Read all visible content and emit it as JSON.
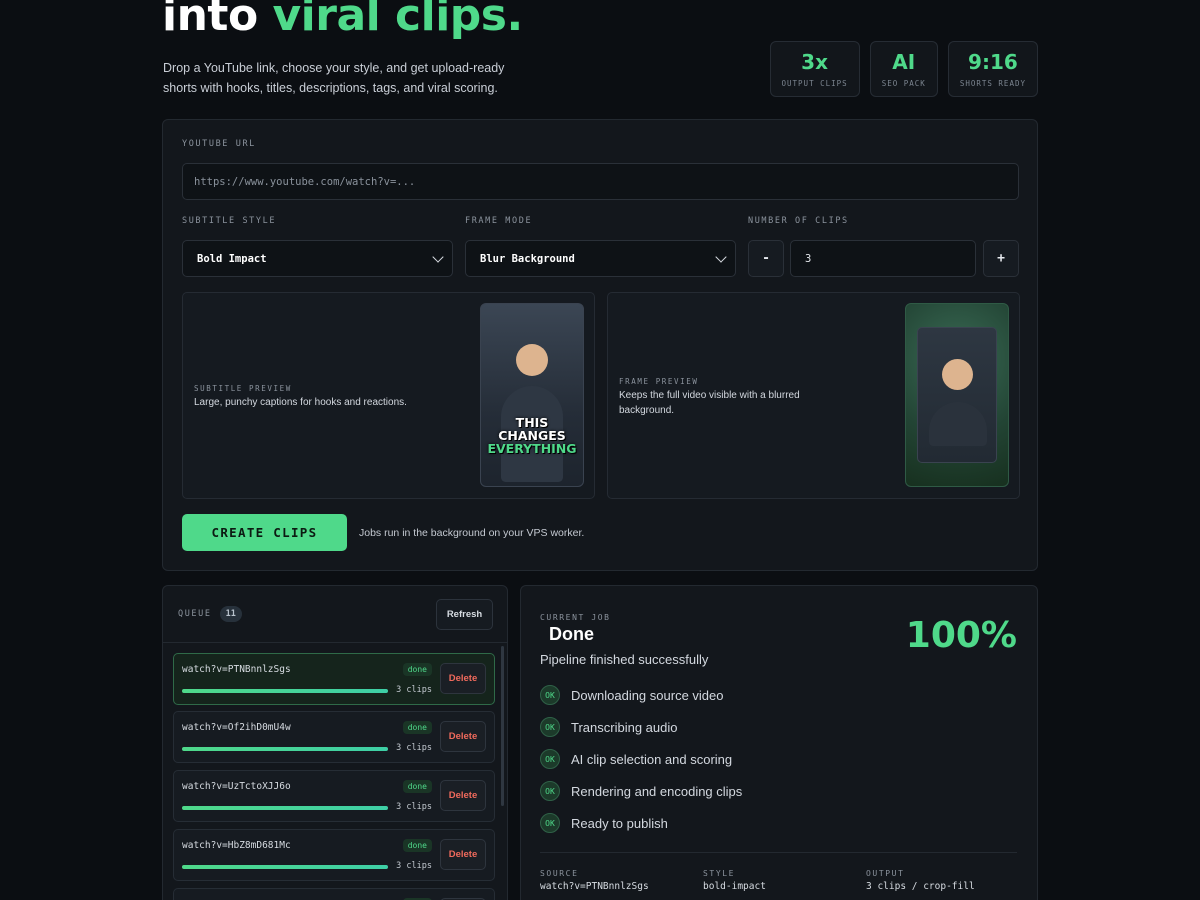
{
  "hero": {
    "title_prefix": "into ",
    "title_accent": "viral clips.",
    "subtitle": "Drop a YouTube link, choose your style, and get upload-ready shorts with hooks, titles, descriptions, tags, and viral scoring."
  },
  "stats": [
    {
      "value": "3x",
      "label": "OUTPUT CLIPS"
    },
    {
      "value": "AI",
      "label": "SEO PACK"
    },
    {
      "value": "9:16",
      "label": "SHORTS READY"
    }
  ],
  "form": {
    "url_label": "YOUTUBE URL",
    "url_placeholder": "https://www.youtube.com/watch?v=...",
    "subtitle_style_label": "SUBTITLE STYLE",
    "subtitle_style_value": "Bold Impact",
    "frame_mode_label": "FRAME MODE",
    "frame_mode_value": "Blur Background",
    "clips_label": "NUMBER OF CLIPS",
    "minus_label": "-",
    "plus_label": "+",
    "clips_value": "3",
    "subtitle_preview_label": "SUBTITLE PREVIEW",
    "subtitle_preview_desc": "Large, punchy captions for hooks and reactions.",
    "caption_line1": "THIS",
    "caption_line2": "CHANGES",
    "caption_line3": "EVERYTHING",
    "frame_preview_label": "FRAME PREVIEW",
    "frame_preview_desc": "Keeps the full video visible with a blurred background.",
    "create_button": "CREATE CLIPS",
    "create_note": "Jobs run in the background on your VPS worker."
  },
  "queue": {
    "label": "QUEUE",
    "count": "11",
    "refresh_label": "Refresh",
    "delete_label": "Delete",
    "items": [
      {
        "id": "watch?v=PTNBnnlzSgs",
        "status": "done",
        "clips": "3 clips",
        "progress": 1.0
      },
      {
        "id": "watch?v=Of2ihD0mU4w",
        "status": "done",
        "clips": "3 clips",
        "progress": 1.0
      },
      {
        "id": "watch?v=UzTctoXJJ6o",
        "status": "done",
        "clips": "3 clips",
        "progress": 1.0
      },
      {
        "id": "watch?v=HbZ8mD681Mc",
        "status": "done",
        "clips": "3 clips",
        "progress": 1.0
      },
      {
        "id": "",
        "status": "done",
        "clips": "",
        "progress": 1.0
      }
    ]
  },
  "job": {
    "label": "CURRENT JOB",
    "status": "Done",
    "percent": "100%",
    "message": "Pipeline finished successfully",
    "ok_label": "OK",
    "steps": [
      "Downloading source video",
      "Transcribing audio",
      "AI clip selection and scoring",
      "Rendering and encoding clips",
      "Ready to publish"
    ],
    "meta": {
      "source_label": "SOURCE",
      "source_value": "watch?v=PTNBnnlzSgs",
      "style_label": "STYLE",
      "style_value": "bold-impact",
      "output_label": "OUTPUT",
      "output_value": "3 clips / crop-fill"
    }
  },
  "colors": {
    "accent": "#4fd98a",
    "background": "#0b0e12",
    "panel": "#13171c",
    "danger": "#f06a5c"
  }
}
